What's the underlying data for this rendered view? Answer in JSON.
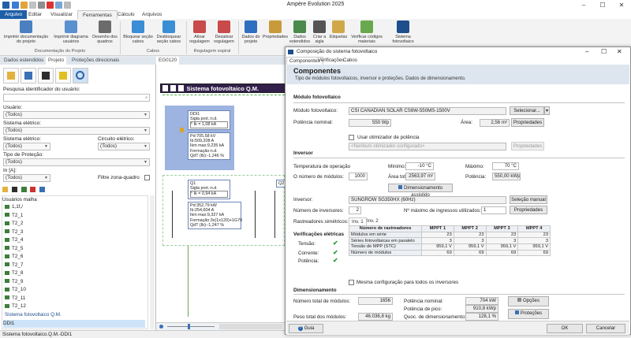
{
  "app": {
    "title": "Ampère Evolution 2025"
  },
  "ribbon": {
    "tabs": [
      "Arquivo",
      "Editar",
      "Visualizar",
      "Ferramentas",
      "Cálculo",
      "Arquivos"
    ],
    "buttons": [
      {
        "label": "Imprimir documentação do projeto"
      },
      {
        "label": "Imprimir diagrama usuários"
      },
      {
        "label": "Desenho dos quadros"
      },
      {
        "label": "Bloquear seção cabos"
      },
      {
        "label": "Desbloquear seção cabos"
      },
      {
        "label": "Ativar regulagem"
      },
      {
        "label": "Desativar regulagem"
      },
      {
        "label": "Dados do projeto"
      },
      {
        "label": "Propriedades"
      },
      {
        "label": "Dados estendidos"
      },
      {
        "label": "Criar a sigla"
      },
      {
        "label": "Etiquetas"
      },
      {
        "label": "Verificar códigos materiais"
      },
      {
        "label": "Sistema fotovoltaico"
      }
    ],
    "groups": [
      "Documentação do Projeto",
      "Cabos",
      "Regulagem espiral"
    ]
  },
  "left": {
    "tabs": [
      "Dados estendidos",
      "Projeto",
      "Proteções direcionais"
    ],
    "search_label": "Pesquisa identificador do usuário:",
    "usuario_label": "Usuário:",
    "usuario_value": "(Todos)",
    "sistema_label": "Sistema elétrico:",
    "sistema_value": "(Todos)",
    "sistema2_label": "Sistema elétrico:",
    "sistema2_value": "(Todos)",
    "circuito_label": "Circuito elétrico:",
    "circuito_value": "(Todos)",
    "tipo_label": "Tipo de Proteção:",
    "tipo_value": "(Todos)",
    "in_label": "In [A]:",
    "in_value": "(Todos)",
    "filtro_label": "Filtre zona-quadro",
    "tree_header": "Usuários malha",
    "tree_items": [
      "1,1f,/",
      "T2_1",
      "T2_2",
      "T2_3",
      "T2_4",
      "T2_5",
      "T2_6",
      "T2_7",
      "T2_8",
      "T2_9",
      "T2_10",
      "T2_11",
      "T2_12"
    ],
    "tree_footer": "Sistema fotovoltaico Q.M.",
    "tree_selected": "DDI1"
  },
  "canvas": {
    "tab": "EG0120",
    "header": "Sistema fotovoltaico Q.M.",
    "box1": [
      "DDI1",
      "Sigla prot.:n.d.",
      "ʰ Ik = 1,08 kA",
      "Pd:705,58 kV",
      "Ib:509,208 A",
      "Ikm max:9,235 kA",
      "Formação:n.d.",
      "QdT (Ib):-1,246 %"
    ],
    "box2": [
      "Q1",
      "Sigla prot.:n.d.",
      "ʰ Ik = 0,94 kA",
      "Pd:352,79 kW",
      "Ib:254,604 A",
      "Ikm max:9,327 kA",
      "Formação:3x(1x120)+1G70",
      "QdT (Ib):-1,247 %"
    ],
    "box3": [
      "Q2",
      "Sigla prot.:n.d."
    ]
  },
  "status": {
    "text": "Sistema fotovoltaico.Q.M.-DDI1"
  },
  "dialog": {
    "title": "Composição do sistema fotovoltaico",
    "tabs": [
      "Componentes",
      "Verificações",
      "Cabos"
    ],
    "heading": "Componentes",
    "subheading": "Tipo de módulos fotovoltaicos, inversor e proteções. Dados de dimensionamento.",
    "modulo": {
      "section": "Módulo fotovoltaico",
      "label": "Módulo fotovoltaico:",
      "value": "CSI CANADIAN SOLAR CS6W-550MS-1500V",
      "select_btn": "Selecionar...",
      "potencia_label": "Potência nominal:",
      "potencia_value": "550 Wp",
      "area_label": "Área:",
      "area_value": "2,56 m²",
      "prop_btn": "Propriedades",
      "otimizador_label": "Usar otimizador de potência",
      "otimizador_value": "<Nenhum otimizador configurado>",
      "prop_btn2": "Propriedades"
    },
    "inversor": {
      "section": "Inversor",
      "temp_label": "Temperatura de operação",
      "min_label": "Mínimo:",
      "min_value": "-10 °C",
      "max_label": "Máximo:",
      "max_value": "70 °C",
      "nmod_label": "O número de módulos:",
      "nmod_value": "1000",
      "areatot_label": "Área total:",
      "areatot_value": "2563,97 m²",
      "pot_label": "Potência:",
      "pot_value": "550,00 kWp",
      "assist_btn": "Dimensionamento assistido",
      "inv_label": "Inversor:",
      "inv_value": "SUNGROW SG350HX (60Hz)",
      "manual_btn": "Seleção manual",
      "ninv_label": "Número de inversores:",
      "ninv_value": "2",
      "ning_label": "Nº máximo de ingressos utilizados:",
      "ning_value": "1",
      "prop_btn": "Propriedades",
      "rast_label": "Rastreadores simétricos:",
      "inv_tabs": [
        "Inv. 1",
        "Inv. 2"
      ]
    },
    "verif": {
      "section": "Verificações elétricas",
      "items": [
        "Tensão:",
        "Corrente:",
        "Potência:"
      ],
      "mark": "✔"
    },
    "mppt": {
      "headers": [
        "Número de rastreadores",
        "MPPT 1",
        "MPPT 2",
        "MPPT 3",
        "MPPT 4"
      ],
      "rows": [
        {
          "label": "Módulos em série",
          "values": [
            "23",
            "23",
            "23",
            "23"
          ]
        },
        {
          "label": "Séries fotovoltaicas em paralelo",
          "values": [
            "3",
            "3",
            "3",
            "3"
          ]
        },
        {
          "label": "Tensão de MPP (STC)",
          "values": [
            "959,1 V",
            "959,1 V",
            "959,1 V",
            "959,1 V"
          ]
        },
        {
          "label": "Número de módulos",
          "values": [
            "69",
            "69",
            "69",
            "69"
          ]
        }
      ],
      "same_config": "Mesma configuração para todos os inversores"
    },
    "dimens": {
      "section": "Dimensionamento",
      "ntot_label": "Número total de módulos:",
      "ntot_value": "1656",
      "potnom_label": "Potência nominal:",
      "potnom_value": "704 kW",
      "potpico_label": "Potência de pico:",
      "potpico_value": "910,8 kWp",
      "peso_label": "Peso total dos módulos:",
      "peso_value": "46.036,8 kg",
      "quoc_label": "Quoc. de dimensionamento:",
      "quoc_value": "128,1 %",
      "opcoes_btn": "Opções",
      "protecoes_btn": "Proteções"
    },
    "footer": {
      "guide": "Guia",
      "ok": "OK",
      "cancel": "Cancelar"
    }
  }
}
